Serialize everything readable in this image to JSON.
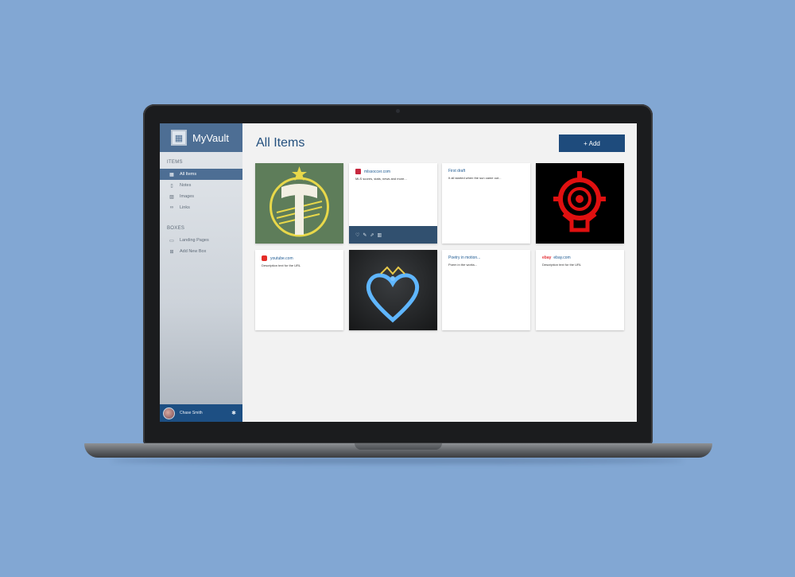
{
  "app": {
    "name": "MyVault",
    "logo_icon": "vault-logo-icon"
  },
  "sidebar": {
    "items_title": "ITEMS",
    "items": [
      {
        "label": "All Items",
        "icon": "grid-icon",
        "active": true
      },
      {
        "label": "Notes",
        "icon": "note-icon",
        "active": false
      },
      {
        "label": "Images",
        "icon": "image-icon",
        "active": false
      },
      {
        "label": "Links",
        "icon": "link-icon",
        "active": false
      }
    ],
    "boxes_title": "BOXES",
    "boxes": [
      {
        "label": "Landing Pages",
        "icon": "inbox-icon"
      },
      {
        "label": "Add New Box",
        "icon": "plus-box-icon"
      }
    ],
    "user": {
      "name": "Chase Smith",
      "settings_icon": "gear-icon"
    }
  },
  "main": {
    "title": "All Items",
    "add_button": "+ Add"
  },
  "cards": [
    {
      "type": "image",
      "image": "portland-timbers-axe-logo"
    },
    {
      "type": "link",
      "title": "mlssoccer.com",
      "description": "MLS scores, stats, news and more...",
      "favicon": "mls-icon",
      "actions": [
        "heart-icon",
        "edit-icon",
        "share-icon",
        "trash-icon"
      ]
    },
    {
      "type": "note",
      "title": "First draft",
      "description": "It all started when the sun came out..."
    },
    {
      "type": "image",
      "image": "red-target-emblem"
    },
    {
      "type": "link",
      "title": "youtube.com",
      "description": "Description text for the URL",
      "favicon": "youtube-icon"
    },
    {
      "type": "image",
      "image": "blue-heart-crown-emblem"
    },
    {
      "type": "note",
      "title": "Poetry in motion...",
      "description": "Poem in the works..."
    },
    {
      "type": "link",
      "title": "ebay.com",
      "description": "Description text for the URL",
      "favicon": "ebay-icon",
      "favicon_text": "ebay"
    }
  ],
  "colors": {
    "background": "#82a7d3",
    "brand": "#4d6e94",
    "button": "#1e4b7c",
    "link": "#1e5a92",
    "user_bar": "#1d4f83"
  }
}
